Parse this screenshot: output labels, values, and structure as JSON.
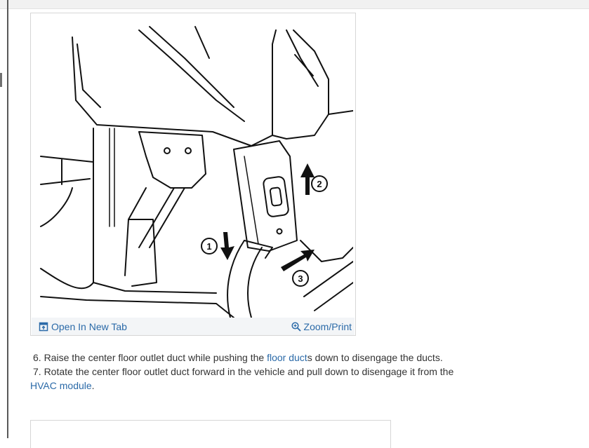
{
  "figure": {
    "callouts": [
      "1",
      "2",
      "3"
    ],
    "toolbar": {
      "open_tab_label": "Open In New Tab",
      "open_tab_icon": "open-new-tab-icon",
      "zoom_label": "Zoom/Print",
      "zoom_icon": "zoom-icon"
    }
  },
  "steps": {
    "step6": {
      "prefix": "6. Raise the center floor outlet duct while pushing the ",
      "link": "floor duct",
      "suffix": "s down to disengage the ducts."
    },
    "step7": {
      "text": "7. Rotate the center floor outlet duct forward in the vehicle and pull down to disengage it from the",
      "link": "HVAC module",
      "suffix": "."
    }
  },
  "colors": {
    "link": "#2b6aa8",
    "body_text": "#333333",
    "toolbar_bg": "#f3f5f7",
    "border": "#d6d6d6"
  }
}
